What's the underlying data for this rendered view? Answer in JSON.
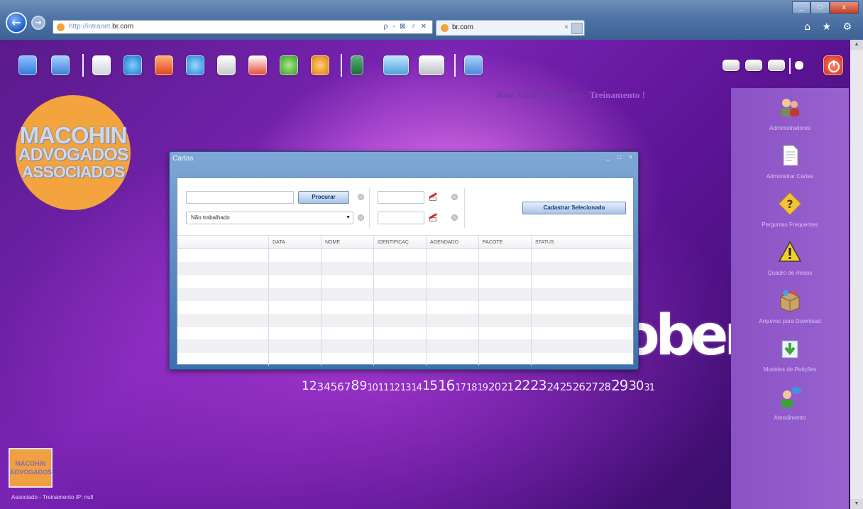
{
  "browser": {
    "address_prefix": "http://",
    "address_host_gray": "intranet.",
    "address_host": "br.com",
    "address_tools": "ρ - ⊠ ♂ ✕",
    "tab_title": "br.com",
    "tab_close": "×",
    "tools": "⌂ ★ ⚙",
    "back": "←",
    "forward": "→"
  },
  "header": {
    "welcome": "Bem Vindo Associado - ",
    "welcome_suffix": "Treinamento !"
  },
  "logo": {
    "line1": "MACOHIN",
    "line2": "ADVOGADOS",
    "line3": "ASSOCIADOS"
  },
  "logo_small": {
    "line1": "MACOHIN",
    "line2": "ADVOGADOS"
  },
  "status_line": "Associado - Treinamento  IP: null",
  "watermark": "ober",
  "days": [
    "1",
    "2",
    "3",
    "4",
    "5",
    "6",
    "7",
    "8",
    "9",
    "10",
    "11",
    "12",
    "13",
    "14",
    "15",
    "16",
    "17",
    "18",
    "19",
    "20",
    "21",
    "22",
    "23",
    "24",
    "25",
    "26",
    "27",
    "28",
    "29",
    "30",
    "31"
  ],
  "sidebar": {
    "items": [
      {
        "label": "Administradores",
        "icon": "users-icon"
      },
      {
        "label": "Administrar Cartas",
        "icon": "document-icon"
      },
      {
        "label": "Perguntas Frequentes",
        "icon": "help-icon"
      },
      {
        "label": "Quadro de Avisos",
        "icon": "warning-icon"
      },
      {
        "label": "Arquivos para Download",
        "icon": "box-icon"
      },
      {
        "label": "Modelos de Petições",
        "icon": "download-folder-icon"
      },
      {
        "label": "Atendimento",
        "icon": "chat-user-icon"
      }
    ]
  },
  "dialog": {
    "title": "Cartas",
    "controls": "_ □ ×",
    "search_button": "Procurar",
    "select_value": "Não trabalhado",
    "register_button": "Cadastrar Selecionado",
    "columns": [
      "",
      "DATA",
      "NOME",
      "IDENTIFICAÇ",
      "AGENDADO",
      "PACOTE",
      "STATUS"
    ]
  },
  "colors": {
    "accent": "#3c6fb0",
    "background": "#7a24b4",
    "sidebar": "#9962cf",
    "logo": "#f4a43e"
  }
}
